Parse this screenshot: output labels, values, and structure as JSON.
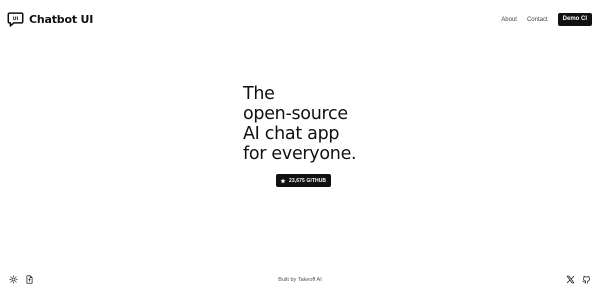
{
  "header": {
    "brand_name": "Chatbot UI",
    "logo_icon": "chat-bubble-logo-icon",
    "nav": {
      "about_label": "About",
      "contact_label": "Contact",
      "demo_label": "Demo CI"
    }
  },
  "hero": {
    "lines": [
      "The",
      "open-source",
      "AI chat app",
      "for everyone."
    ],
    "github_button": {
      "icon": "star-icon",
      "label": "23,675 GITHUB"
    }
  },
  "footer": {
    "left_icons": [
      "sun-icon",
      "document-icon"
    ],
    "credit_text": "Built by Takeoff AI",
    "right_icons": [
      "x-logo-icon",
      "github-icon"
    ]
  },
  "colors": {
    "background": "#ffffff",
    "text": "#111111",
    "button_bg": "#111111",
    "button_text": "#ffffff"
  }
}
